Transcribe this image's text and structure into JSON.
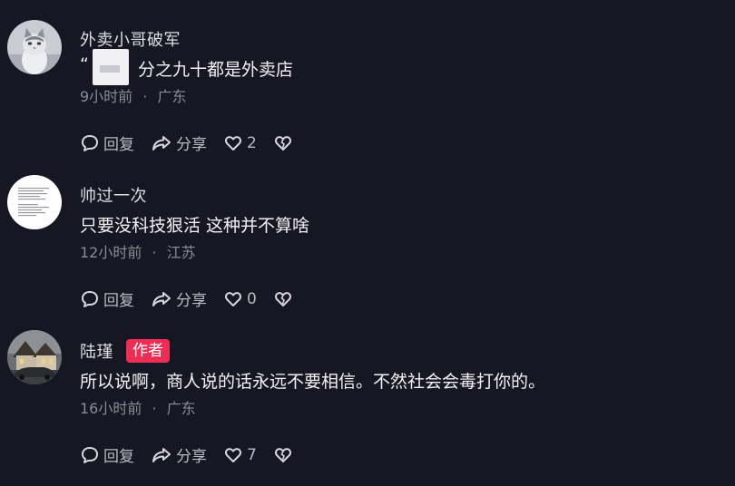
{
  "comments": [
    {
      "username": "外卖小哥破军",
      "text_prefix": "“",
      "text": "分之九十都是外卖店",
      "time": "9小时前",
      "location": "广东",
      "reply_label": "回复",
      "share_label": "分享",
      "likes": "2",
      "avatar_icon": "cat-avatar-icon",
      "is_author": false
    },
    {
      "username": "帅过一次",
      "text": "只要没科技狠活 这种并不算啥",
      "time": "12小时前",
      "location": "江苏",
      "reply_label": "回复",
      "share_label": "分享",
      "likes": "0",
      "avatar_icon": "text-note-avatar-icon",
      "is_author": false
    },
    {
      "username": "陆瑾",
      "author_badge": "作者",
      "text": "所以说啊，商人说的话永远不要相信。不然社会会毒打你的。",
      "time": "16小时前",
      "location": "广东",
      "reply_label": "回复",
      "share_label": "分享",
      "likes": "7",
      "avatar_icon": "house-car-avatar-icon",
      "is_author": true
    }
  ],
  "separator": "·",
  "colors": {
    "background": "#161722",
    "author_badge": "#ee2d55",
    "meta_text": "#8a8b95"
  }
}
